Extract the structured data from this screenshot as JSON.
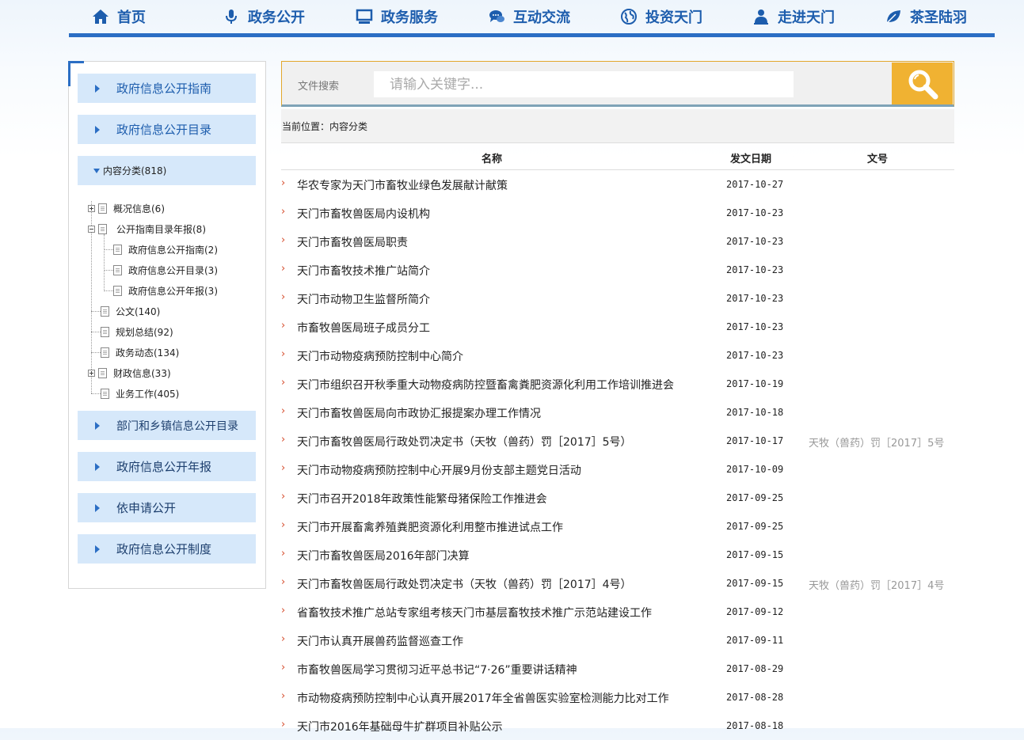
{
  "nav": {
    "items": [
      {
        "label": "首页",
        "icon": "home-icon"
      },
      {
        "label": "政务公开",
        "icon": "microphone-icon"
      },
      {
        "label": "政务服务",
        "icon": "monitor-icon"
      },
      {
        "label": "互动交流",
        "icon": "chat-icon"
      },
      {
        "label": "投资天门",
        "icon": "globe-icon"
      },
      {
        "label": "走进天门",
        "icon": "person-icon"
      },
      {
        "label": "茶圣陆羽",
        "icon": "leaf-icon"
      }
    ],
    "color": "#1d5dad"
  },
  "sidebar": {
    "top_items": [
      {
        "label": "政府信息公开指南"
      },
      {
        "label": "政府信息公开目录"
      }
    ],
    "expanded": {
      "label": "内容分类(818)"
    },
    "tree": [
      {
        "label": "概况信息(6)"
      },
      {
        "label": "公开指南目录年报(8)"
      },
      {
        "label": "政府信息公开指南(2)"
      },
      {
        "label": "政府信息公开目录(3)"
      },
      {
        "label": "政府信息公开年报(3)"
      },
      {
        "label": "公文(140)"
      },
      {
        "label": "规划总结(92)"
      },
      {
        "label": "政务动态(134)"
      },
      {
        "label": "财政信息(33)"
      },
      {
        "label": "业务工作(405)"
      }
    ],
    "bottom_items": [
      {
        "label": "部门和乡镇信息公开目录"
      },
      {
        "label": "政府信息公开年报"
      },
      {
        "label": "依申请公开"
      },
      {
        "label": "政府信息公开制度"
      }
    ]
  },
  "search": {
    "label": "文件搜索",
    "placeholder": "请输入关键字..."
  },
  "breadcrumb": {
    "text": "当前位置：内容分类"
  },
  "table": {
    "headers": {
      "name": "名称",
      "date": "发文日期",
      "docno": "文号"
    },
    "rows": [
      {
        "title": "华农专家为天门市畜牧业绿色发展献计献策",
        "date": "2017-10-27",
        "docno": ""
      },
      {
        "title": "天门市畜牧兽医局内设机构",
        "date": "2017-10-23",
        "docno": ""
      },
      {
        "title": "天门市畜牧兽医局职责",
        "date": "2017-10-23",
        "docno": ""
      },
      {
        "title": "天门市畜牧技术推广站简介",
        "date": "2017-10-23",
        "docno": ""
      },
      {
        "title": "天门市动物卫生监督所简介",
        "date": "2017-10-23",
        "docno": ""
      },
      {
        "title": "市畜牧兽医局班子成员分工",
        "date": "2017-10-23",
        "docno": ""
      },
      {
        "title": "天门市动物疫病预防控制中心简介",
        "date": "2017-10-23",
        "docno": ""
      },
      {
        "title": "天门市组织召开秋季重大动物疫病防控暨畜禽粪肥资源化利用工作培训推进会",
        "date": "2017-10-19",
        "docno": ""
      },
      {
        "title": "天门市畜牧兽医局向市政协汇报提案办理工作情况",
        "date": "2017-10-18",
        "docno": ""
      },
      {
        "title": "天门市畜牧兽医局行政处罚决定书（天牧（兽药）罚［2017］5号）",
        "date": "2017-10-17",
        "docno": "天牧（兽药）罚［2017］5号"
      },
      {
        "title": "天门市动物疫病预防控制中心开展9月份支部主题党日活动",
        "date": "2017-10-09",
        "docno": ""
      },
      {
        "title": "天门市召开2018年政策性能繁母猪保险工作推进会",
        "date": "2017-09-25",
        "docno": ""
      },
      {
        "title": "天门市开展畜禽养殖粪肥资源化利用整市推进试点工作",
        "date": "2017-09-25",
        "docno": ""
      },
      {
        "title": "天门市畜牧兽医局2016年部门决算",
        "date": "2017-09-15",
        "docno": ""
      },
      {
        "title": "天门市畜牧兽医局行政处罚决定书（天牧（兽药）罚［2017］4号）",
        "date": "2017-09-15",
        "docno": "天牧（兽药）罚［2017］4号"
      },
      {
        "title": "省畜牧技术推广总站专家组考核天门市基层畜牧技术推广示范站建设工作",
        "date": "2017-09-12",
        "docno": ""
      },
      {
        "title": "天门市认真开展兽药监督巡查工作",
        "date": "2017-09-11",
        "docno": ""
      },
      {
        "title": "市畜牧兽医局学习贯彻习近平总书记“7·26”重要讲话精神",
        "date": "2017-08-29",
        "docno": ""
      },
      {
        "title": "市动物疫病预防控制中心认真开展2017年全省兽医实验室检测能力比对工作",
        "date": "2017-08-28",
        "docno": ""
      },
      {
        "title": "天门市2016年基础母牛扩群项目补贴公示",
        "date": "2017-08-18",
        "docno": ""
      }
    ]
  }
}
